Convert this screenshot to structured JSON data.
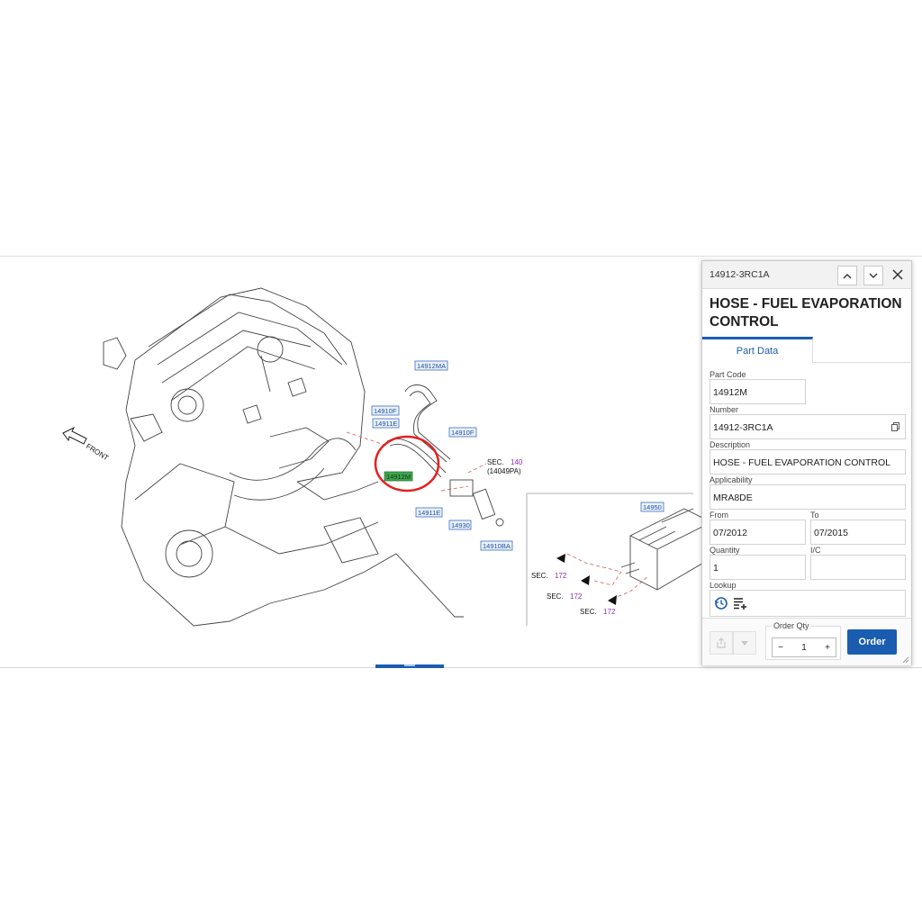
{
  "diagram": {
    "callouts": [
      {
        "id": "c-14912ma",
        "text": "14912MA"
      },
      {
        "id": "c-14910f-a",
        "text": "14910F"
      },
      {
        "id": "c-14911e-a",
        "text": "14911E"
      },
      {
        "id": "c-14910f-b",
        "text": "14910F"
      },
      {
        "id": "c-14912m",
        "text": "14912M"
      },
      {
        "id": "c-14911e-b",
        "text": "14911E"
      },
      {
        "id": "c-14930",
        "text": "14930"
      },
      {
        "id": "c-14910ba",
        "text": "14910BA"
      },
      {
        "id": "c-14950",
        "text": "14950"
      }
    ],
    "front_label": "FRONT",
    "sec_140": {
      "label": "SEC.",
      "num": "140",
      "sub": "(14049PA)"
    },
    "sec_172": [
      {
        "label": "SEC.",
        "num": "172"
      },
      {
        "label": "SEC.",
        "num": "172"
      },
      {
        "label": "SEC.",
        "num": "172"
      }
    ],
    "highlight_color": "#e32020",
    "selected_callout_color": "#3fa34d"
  },
  "panel": {
    "code": "14912-3RC1A",
    "title": "HOSE - FUEL EVAPORATION CONTROL",
    "tab": "Part Data",
    "part_code": {
      "label": "Part Code",
      "value": "14912M"
    },
    "number": {
      "label": "Number",
      "value": "14912-3RC1A"
    },
    "description": {
      "label": "Description",
      "value": "HOSE - FUEL EVAPORATION CONTROL"
    },
    "applicability": {
      "label": "Applicability",
      "value": "MRA8DE"
    },
    "from": {
      "label": "From",
      "value": "07/2012"
    },
    "to": {
      "label": "To",
      "value": "07/2015"
    },
    "quantity": {
      "label": "Quantity",
      "value": "1"
    },
    "ic": {
      "label": "I/C",
      "value": ""
    },
    "lookup": {
      "label": "Lookup"
    },
    "order_qty": {
      "label": "Order Qty",
      "value": "1",
      "minus": "−",
      "plus": "+"
    },
    "order_label": "Order",
    "accent": "#1a5db0"
  }
}
